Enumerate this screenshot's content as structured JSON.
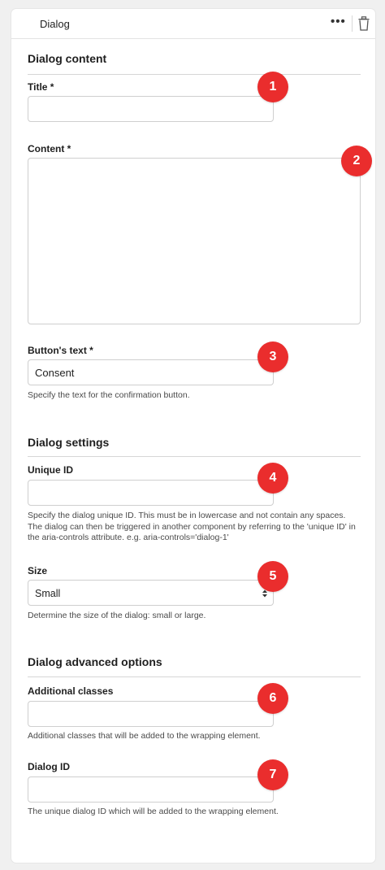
{
  "header": {
    "title": "Dialog",
    "more_icon": "more-horizontal-icon",
    "delete_icon": "trash-icon"
  },
  "sections": {
    "content": "Dialog content",
    "settings": "Dialog settings",
    "advanced": "Dialog advanced options"
  },
  "fields": {
    "title": {
      "label": "Title *",
      "value": ""
    },
    "content": {
      "label": "Content *",
      "value": ""
    },
    "button_text": {
      "label": "Button's text *",
      "value": "Consent",
      "help": "Specify the text for the confirmation button."
    },
    "unique_id": {
      "label": "Unique ID",
      "value": "",
      "help": "Specify the dialog unique ID. This must be in lowercase and not contain any spaces. The dialog can then be triggered in another component by referring to the 'unique ID' in the aria-controls attribute. e.g. aria-controls='dialog-1'"
    },
    "size": {
      "label": "Size",
      "value": "Small",
      "help": "Determine the size of the dialog: small or large."
    },
    "additional_classes": {
      "label": "Additional classes",
      "value": "",
      "help": "Additional classes that will be added to the wrapping element."
    },
    "dialog_id": {
      "label": "Dialog ID",
      "value": "",
      "help": "The unique dialog ID which will be added to the wrapping element."
    }
  },
  "badges": [
    "1",
    "2",
    "3",
    "4",
    "5",
    "6",
    "7"
  ],
  "colors": {
    "badge": "#ea2d2d",
    "border": "#cfcfcf",
    "panel": "#ffffff",
    "background": "#f0f0f0"
  }
}
